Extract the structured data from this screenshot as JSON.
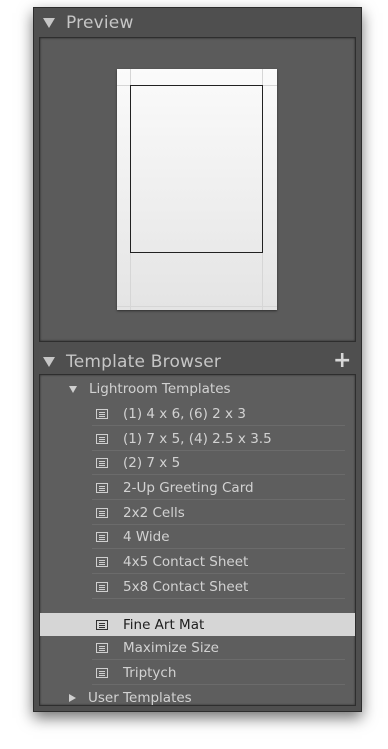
{
  "preview": {
    "title": "Preview"
  },
  "template_browser": {
    "title": "Template Browser",
    "add_icon": "plus-icon",
    "folders": [
      {
        "label": "Lightroom Templates",
        "expanded": true,
        "items": [
          {
            "label": "(1) 4 x 6, (6) 2 x 3",
            "selected": false
          },
          {
            "label": "(1) 7 x 5, (4) 2.5 x 3.5",
            "selected": false
          },
          {
            "label": "(2) 7 x 5",
            "selected": false
          },
          {
            "label": "2-Up Greeting Card",
            "selected": false
          },
          {
            "label": "2x2 Cells",
            "selected": false
          },
          {
            "label": "4 Wide",
            "selected": false
          },
          {
            "label": "4x5 Contact Sheet",
            "selected": false
          },
          {
            "label": "5x8 Contact Sheet",
            "selected": false
          },
          {
            "label": "Fine Art Mat",
            "selected": true
          },
          {
            "label": "Maximize Size",
            "selected": false
          },
          {
            "label": "Triptych",
            "selected": false
          }
        ]
      },
      {
        "label": "User Templates",
        "expanded": false,
        "items": []
      }
    ]
  }
}
